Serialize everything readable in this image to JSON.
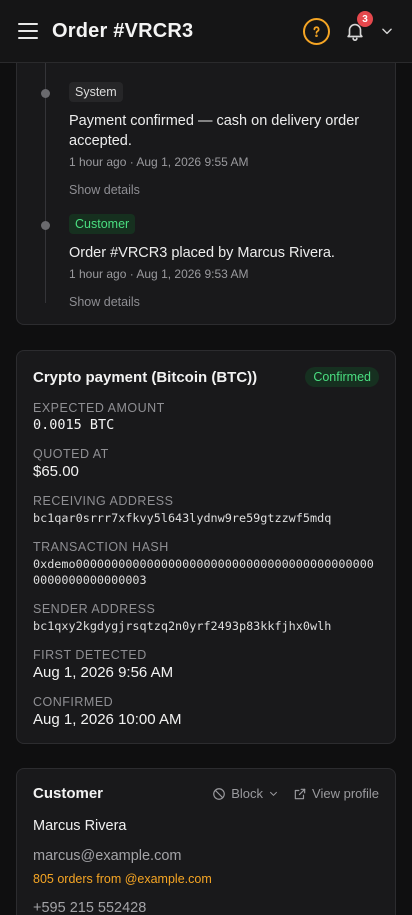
{
  "header": {
    "title": "Order #VRCR3",
    "notification_count": "3",
    "accent": "#f5a524"
  },
  "timeline": {
    "items": [
      {
        "tag": "System",
        "title": "Payment confirmed — cash on delivery order accepted.",
        "meta": "1 hour ago · Aug 1, 2026 9:55 AM",
        "link": "Show details"
      },
      {
        "tag": "Customer",
        "title": "Order #VRCR3 placed by Marcus Rivera.",
        "meta": "1 hour ago · Aug 1, 2026 9:53 AM",
        "link": "Show details"
      }
    ]
  },
  "crypto": {
    "title": "Crypto payment (Bitcoin (BTC))",
    "status": "Confirmed",
    "fields": [
      {
        "label": "EXPECTED AMOUNT",
        "value": "0.0015 BTC"
      },
      {
        "label": "QUOTED AT",
        "value": "$65.00"
      },
      {
        "label": "RECEIVING ADDRESS",
        "value": "bc1qar0srrr7xfkvy5l643lydnw9re59gtzzwf5mdq"
      },
      {
        "label": "TRANSACTION HASH",
        "value": "0xdemo0000000000000000000000000000000000000000000000000000000003"
      },
      {
        "label": "SENDER ADDRESS",
        "value": "bc1qxy2kgdygjrsqtzq2n0yrf2493p83kkfjhx0wlh"
      },
      {
        "label": "FIRST DETECTED",
        "value": "Aug 1, 2026 9:56 AM"
      },
      {
        "label": "CONFIRMED",
        "value": "Aug 1, 2026 10:00 AM"
      }
    ]
  },
  "customer": {
    "heading": "Customer",
    "block_label": "Block",
    "view_profile_label": "View profile",
    "name": "Marcus Rivera",
    "email": "marcus@example.com",
    "orders_note": "805 orders from @example.com",
    "phone": "+595 215 552428"
  }
}
